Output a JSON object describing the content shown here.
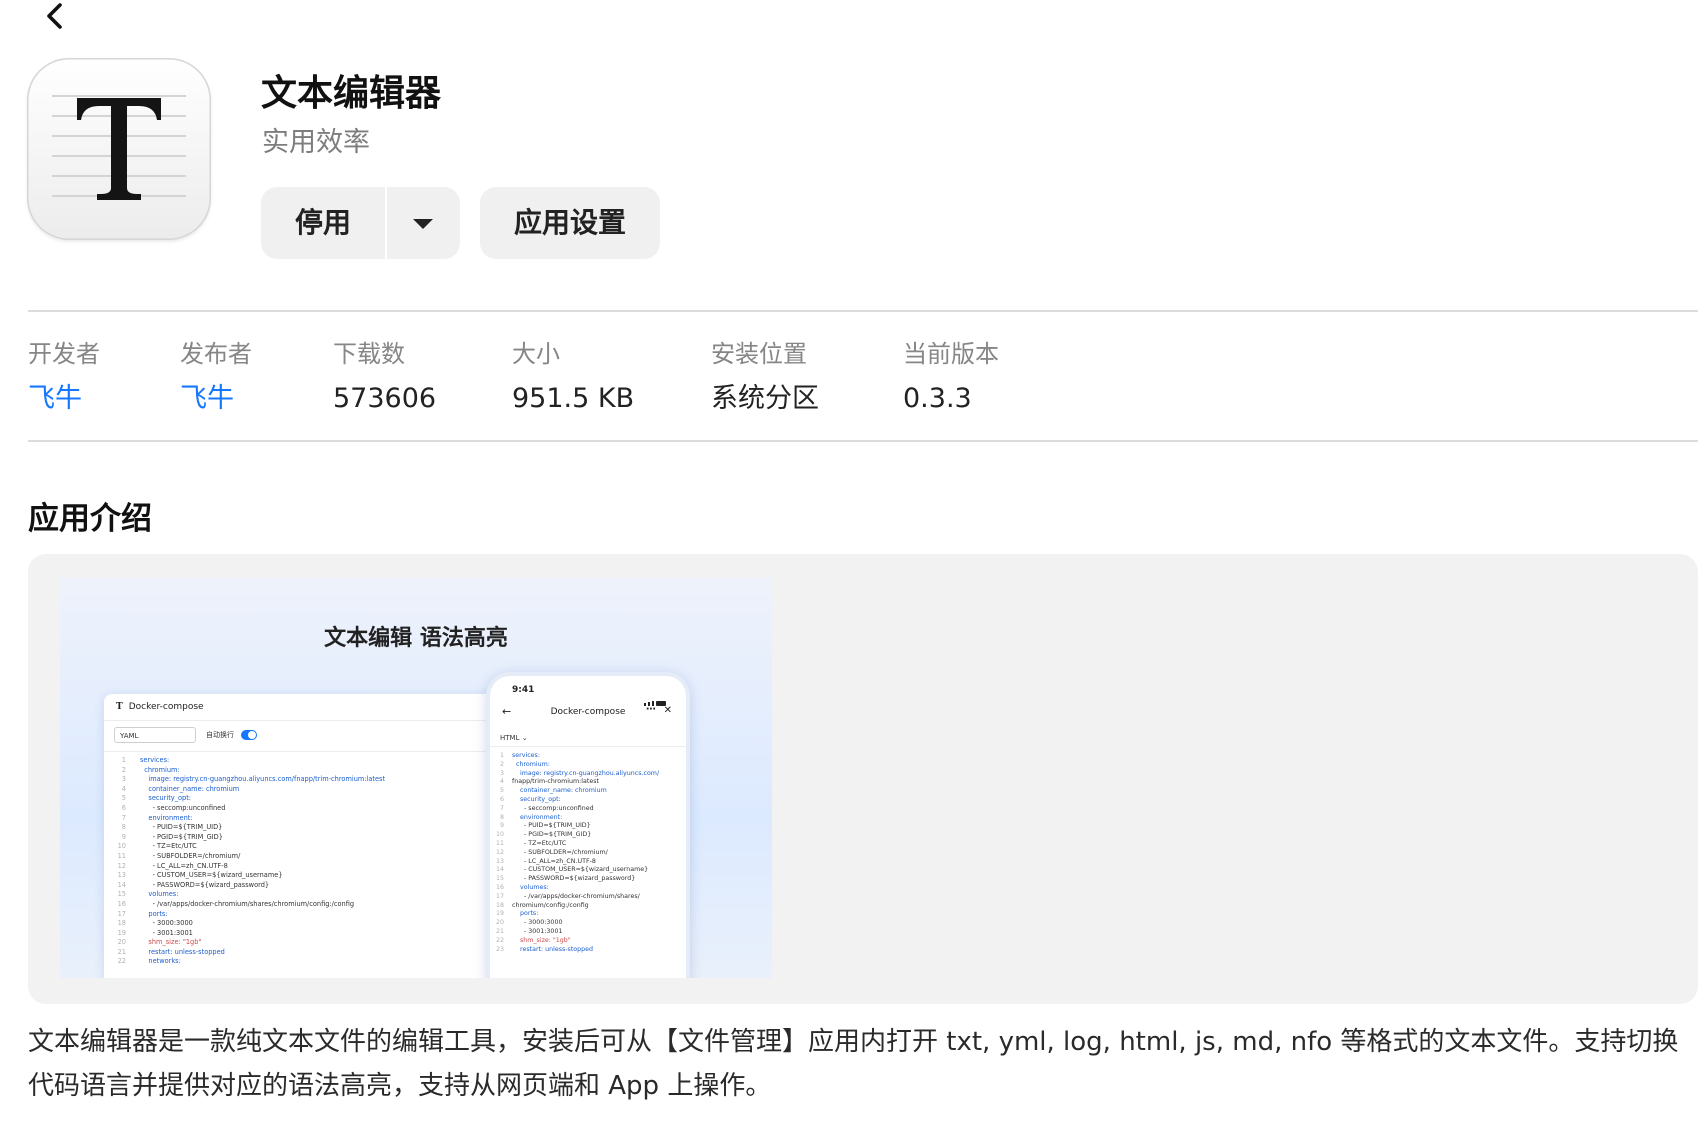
{
  "app": {
    "name": "文本编辑器",
    "category": "实用效率"
  },
  "actions": {
    "disable_label": "停用",
    "settings_label": "应用设置"
  },
  "info": [
    {
      "label": "开发者",
      "value": "飞牛",
      "link": true
    },
    {
      "label": "发布者",
      "value": "飞牛",
      "link": true
    },
    {
      "label": "下载数",
      "value": "573606",
      "link": false
    },
    {
      "label": "大小",
      "value": "951.5 KB",
      "link": false
    },
    {
      "label": "安装位置",
      "value": "系统分区",
      "link": false
    },
    {
      "label": "当前版本",
      "value": "0.3.3",
      "link": false
    }
  ],
  "intro": {
    "title": "应用介绍",
    "screenshot": {
      "headline": "文本编辑  语法高亮",
      "desktop": {
        "window_title": "Docker-compose",
        "language": "YAML",
        "wrap_label": "自动换行",
        "code_lines": [
          "services:",
          "  chromium:",
          "    image: registry.cn-guangzhou.aliyuncs.com/fnapp/trim-chromium:latest",
          "    container_name: chromium",
          "    security_opt:",
          "      - seccomp:unconfined",
          "    environment:",
          "      - PUID=${TRIM_UID}",
          "      - PGID=${TRIM_GID}",
          "      - TZ=Etc/UTC",
          "      - SUBFOLDER=/chromium/",
          "      - LC_ALL=zh_CN.UTF-8",
          "      - CUSTOM_USER=${wizard_username}",
          "      - PASSWORD=${wizard_password}",
          "    volumes:",
          "      - /var/apps/docker-chromium/shares/chromium/config:/config",
          "    ports:",
          "      - 3000:3000",
          "      - 3001:3001",
          "    shm_size: \"1gb\"",
          "    restart: unless-stopped",
          "    networks:"
        ]
      },
      "mobile": {
        "time": "9:41",
        "title": "Docker-compose",
        "language": "HTML",
        "code_lines": [
          "services:",
          "  chromium:",
          "    image: registry.cn-guangzhou.aliyuncs.com/",
          "fnapp/trim-chromium:latest",
          "    container_name: chromium",
          "    security_opt:",
          "      - seccomp:unconfined",
          "    environment:",
          "      - PUID=${TRIM_UID}",
          "      - PGID=${TRIM_GID}",
          "      - TZ=Etc/UTC",
          "      - SUBFOLDER=/chromium/",
          "      - LC_ALL=zh_CN.UTF-8",
          "      - CUSTOM_USER=${wizard_username}",
          "      - PASSWORD=${wizard_password}",
          "    volumes:",
          "      - /var/apps/docker-chromium/shares/",
          "chromium/config:/config",
          "    ports:",
          "      - 3000:3000",
          "      - 3001:3001",
          "    shm_size: \"1gb\"",
          "    restart: unless-stopped"
        ]
      }
    },
    "description": "文本编辑器是一款纯文本文件的编辑工具，安装后可从【文件管理】应用内打开 txt, yml, log, html, js, md, nfo 等格式的文本文件。支持切换代码语言并提供对应的语法高亮，支持从网页端和 App 上操作。"
  },
  "colors": {
    "link": "#1677ff",
    "button_bg": "#f0f0f0",
    "gallery_bg": "#f2f2f2"
  },
  "icons": [
    "back-arrow-icon",
    "text-editor-app-icon",
    "caret-down-icon"
  ]
}
